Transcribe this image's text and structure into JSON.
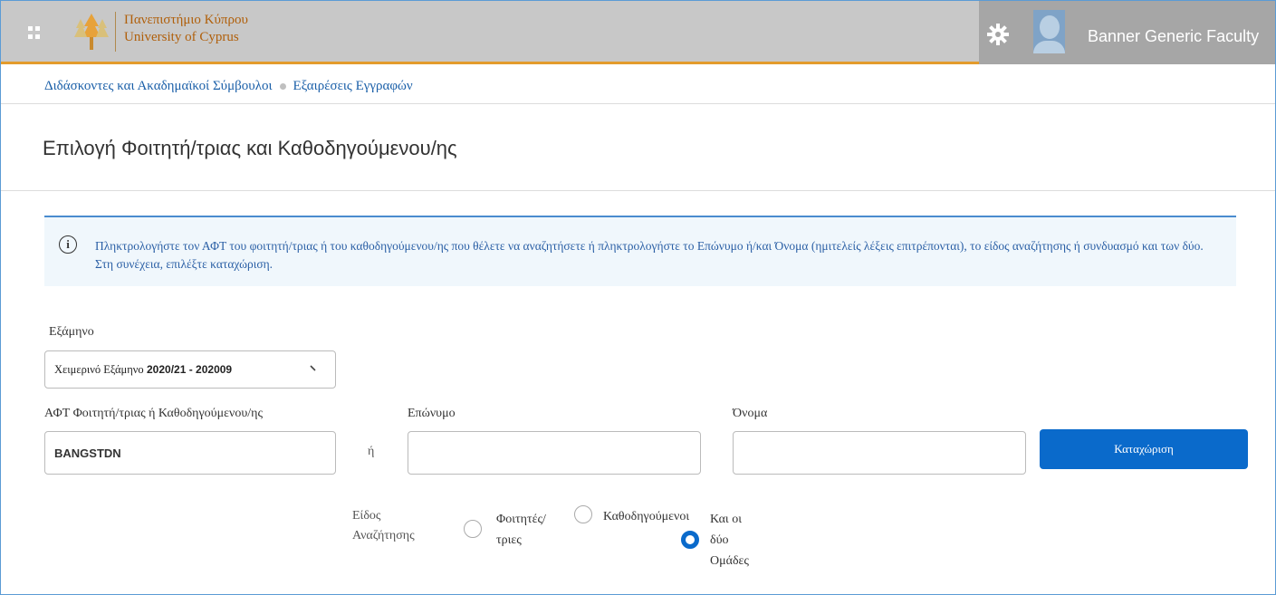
{
  "header": {
    "university_name_gr": "Πανεπιστήμιο Κύπρου",
    "university_name_en": "University of Cyprus",
    "user_name": "Banner Generic Faculty",
    "colors": {
      "bar": "#c8c8c8",
      "accent": "#e39b2c",
      "brand_text": "#b05f0a"
    }
  },
  "breadcrumb": {
    "items": [
      "Διδάσκοντες και Ακαδημαϊκοί Σύμβουλοι",
      "Εξαιρέσεις Εγγραφών"
    ]
  },
  "page_title": "Επιλογή Φοιτητή/τριας και Καθοδηγούμενου/ης",
  "info": {
    "text": "Πληκτρολογήστε τον ΑΦΤ του φοιτητή/τριας ή του καθοδηγούμενου/ης που θέλετε να αναζητήσετε ή πληκτρολογήστε το Επώνυμο ή/και Όνομα (ημιτελείς λέξεις επιτρέπονται), το είδος αναζήτησης ή συνδυασμό και των δύο. Στη συνέχεια, επιλέξτε καταχώριση."
  },
  "form": {
    "term_label": "Εξάμηνο",
    "term_value_text": "Χειμερινό Εξάμηνο",
    "term_value_code": "2020/21 - 202009",
    "id_label": "ΑΦΤ Φοιτητή/τριας ή Καθοδηγούμενου/ης",
    "id_value": "BANGSTDN",
    "or_text": "ή",
    "surname_label": "Επώνυμο",
    "surname_value": "",
    "name_label": "Όνομα",
    "name_value": "",
    "submit_label": "Καταχώριση",
    "search_type_label_1": "Είδος",
    "search_type_label_2": "Αναζήτησης",
    "options": [
      {
        "line1": "Φοιτητές/",
        "line2": "τριες",
        "selected": false
      },
      {
        "line1": "Καθοδηγούμενοι",
        "selected": false
      },
      {
        "line1": "Και οι",
        "line2": "δύο",
        "line3": "Ομάδες",
        "selected": true
      }
    ]
  }
}
